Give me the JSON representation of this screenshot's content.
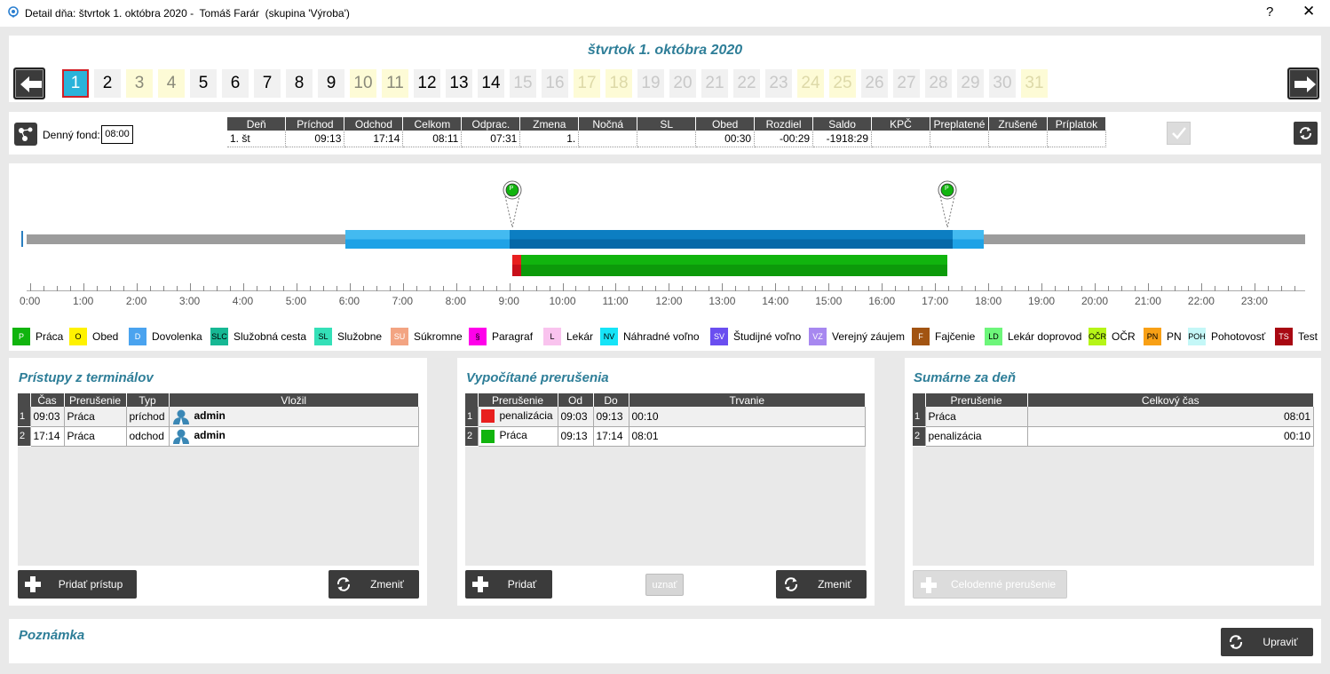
{
  "window": {
    "title": "Detail dňa: štvrtok 1. októbra 2020 -  Tomáš Farár  (skupina 'Výroba')",
    "help": "?",
    "close": "✕"
  },
  "date_heading": "štvrtok 1. októbra 2020",
  "days": [
    {
      "n": "1",
      "type": "selected"
    },
    {
      "n": "2",
      "type": "work"
    },
    {
      "n": "3",
      "type": "weekend"
    },
    {
      "n": "4",
      "type": "weekend"
    },
    {
      "n": "5",
      "type": "work"
    },
    {
      "n": "6",
      "type": "work"
    },
    {
      "n": "7",
      "type": "work"
    },
    {
      "n": "8",
      "type": "work"
    },
    {
      "n": "9",
      "type": "work"
    },
    {
      "n": "10",
      "type": "weekend"
    },
    {
      "n": "11",
      "type": "weekend"
    },
    {
      "n": "12",
      "type": "work"
    },
    {
      "n": "13",
      "type": "work"
    },
    {
      "n": "14",
      "type": "work"
    },
    {
      "n": "15",
      "type": "future"
    },
    {
      "n": "16",
      "type": "future"
    },
    {
      "n": "17",
      "type": "future-weekend"
    },
    {
      "n": "18",
      "type": "future-weekend"
    },
    {
      "n": "19",
      "type": "future"
    },
    {
      "n": "20",
      "type": "future"
    },
    {
      "n": "21",
      "type": "future"
    },
    {
      "n": "22",
      "type": "future"
    },
    {
      "n": "23",
      "type": "future"
    },
    {
      "n": "24",
      "type": "future-weekend"
    },
    {
      "n": "25",
      "type": "future-weekend"
    },
    {
      "n": "26",
      "type": "future"
    },
    {
      "n": "27",
      "type": "future"
    },
    {
      "n": "28",
      "type": "future"
    },
    {
      "n": "29",
      "type": "future"
    },
    {
      "n": "30",
      "type": "future"
    },
    {
      "n": "31",
      "type": "future-weekend"
    }
  ],
  "fund": {
    "label": "Denný fond:",
    "value": "08:00"
  },
  "summary": {
    "headers": [
      "Deň",
      "Príchod",
      "Odchod",
      "Celkom",
      "Odprac.",
      "Zmena",
      "Nočná",
      "SL",
      "Obed",
      "Rozdiel",
      "Saldo",
      "KPČ",
      "Preplatené",
      "Zrušené",
      "Príplatok"
    ],
    "row": [
      "1. št",
      "09:13",
      "17:14",
      "08:11",
      "07:31",
      "1.",
      "",
      "",
      "00:30",
      "-00:29",
      "-1918:29",
      "",
      "",
      "",
      ""
    ]
  },
  "timeline": {
    "hours": [
      "0:00",
      "1:00",
      "2:00",
      "3:00",
      "4:00",
      "5:00",
      "6:00",
      "7:00",
      "8:00",
      "9:00",
      "10:00",
      "11:00",
      "12:00",
      "13:00",
      "14:00",
      "15:00",
      "16:00",
      "17:00",
      "18:00",
      "19:00",
      "20:00",
      "21:00",
      "22:00",
      "23:00"
    ],
    "shift_window": {
      "start_hour": 6.0,
      "end_hour": 18.0
    },
    "shift_core": {
      "start_hour": 9.0,
      "end_hour": 17.5
    },
    "pins": [
      {
        "hour": 9.05,
        "label": "P"
      },
      {
        "hour": 17.23,
        "label": "P"
      }
    ],
    "breaks": [
      {
        "label": "penalizácia",
        "start_hour": 9.05,
        "end_hour": 9.22,
        "color": "#e8201f"
      },
      {
        "label": "Práca",
        "start_hour": 9.22,
        "end_hour": 17.23,
        "color": "#11b40e"
      }
    ]
  },
  "legend": [
    {
      "code": "P",
      "label": "Práca",
      "color": "#11b40e",
      "fg": "#fff"
    },
    {
      "code": "O",
      "label": "Obed",
      "color": "#fff200",
      "fg": "#000"
    },
    {
      "code": "D",
      "label": "Dovolenka",
      "color": "#4aa3ef",
      "fg": "#fff"
    },
    {
      "code": "SLC",
      "label": "Služobná cesta",
      "color": "#17b894",
      "fg": "#000"
    },
    {
      "code": "SL",
      "label": "Služobne",
      "color": "#34e0b8",
      "fg": "#000"
    },
    {
      "code": "SU",
      "label": "Súkromne",
      "color": "#f3a482",
      "fg": "#fff"
    },
    {
      "code": "§",
      "label": "Paragraf",
      "color": "#ff00ea",
      "fg": "#000"
    },
    {
      "code": "L",
      "label": "Lekár",
      "color": "#f9c3ee",
      "fg": "#000"
    },
    {
      "code": "NV",
      "label": "Náhradné voľno",
      "color": "#16e4f7",
      "fg": "#000"
    },
    {
      "code": "SV",
      "label": "Študijné voľno",
      "color": "#6a4ef0",
      "fg": "#fff"
    },
    {
      "code": "VZ",
      "label": "Verejný záujem",
      "color": "#a788f0",
      "fg": "#fff"
    },
    {
      "code": "F",
      "label": "Fajčenie",
      "color": "#a25412",
      "fg": "#fff"
    },
    {
      "code": "LD",
      "label": "Lekár doprovod",
      "color": "#6df67a",
      "fg": "#000"
    },
    {
      "code": "OČR",
      "label": "OČR",
      "color": "#b6f517",
      "fg": "#000"
    },
    {
      "code": "PN",
      "label": "PN",
      "color": "#f8a015",
      "fg": "#000"
    },
    {
      "code": "POH",
      "label": "Pohotovosť",
      "color": "#c4f7f7",
      "fg": "#000"
    },
    {
      "code": "TS",
      "label": "Test",
      "color": "#a80812",
      "fg": "#fff"
    }
  ],
  "access": {
    "title": "Prístupy z terminálov",
    "headers": [
      "Čas",
      "Prerušenie",
      "Typ",
      "Vložil"
    ],
    "rows": [
      {
        "n": "1",
        "cas": "09:03",
        "prer": "Práca",
        "typ": "príchod",
        "user": "admin"
      },
      {
        "n": "2",
        "cas": "17:14",
        "prer": "Práca",
        "typ": "odchod",
        "user": "admin"
      }
    ],
    "add_label": "Pridať prístup",
    "change_label": "Zmeniť"
  },
  "computed": {
    "title": "Vypočítané prerušenia",
    "headers": [
      "Prerušenie",
      "Od",
      "Do",
      "Trvanie"
    ],
    "rows": [
      {
        "n": "1",
        "color": "#e8201f",
        "prer": "penalizácia",
        "od": "09:03",
        "do": "09:13",
        "trv": "00:10"
      },
      {
        "n": "2",
        "color": "#11b40e",
        "prer": "Práca",
        "od": "09:13",
        "do": "17:14",
        "trv": "08:01"
      }
    ],
    "add_label": "Pridať",
    "accept_label": "uznať",
    "change_label": "Zmeniť"
  },
  "daily": {
    "title": "Sumárne za deň",
    "headers": [
      "Prerušenie",
      "Celkový čas"
    ],
    "rows": [
      {
        "n": "1",
        "prer": "Práca",
        "cas": "08:01"
      },
      {
        "n": "2",
        "prer": "penalizácia",
        "cas": "00:10"
      }
    ],
    "allday_label": "Celodenné prerušenie"
  },
  "note": {
    "title": "Poznámka",
    "edit_label": "Upraviť"
  }
}
